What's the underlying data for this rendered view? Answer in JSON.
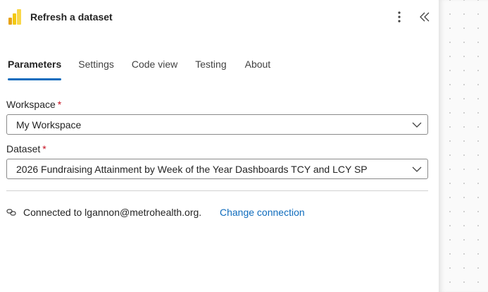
{
  "header": {
    "title": "Refresh a dataset",
    "logo_icon": "power-bi-logo",
    "more_icon": "more-vertical-icon",
    "collapse_icon": "chevron-double-left-icon"
  },
  "tabs": [
    {
      "label": "Parameters",
      "active": true
    },
    {
      "label": "Settings",
      "active": false
    },
    {
      "label": "Code view",
      "active": false
    },
    {
      "label": "Testing",
      "active": false
    },
    {
      "label": "About",
      "active": false
    }
  ],
  "workspace": {
    "label": "Workspace",
    "required_mark": "*",
    "value": "My Workspace"
  },
  "dataset": {
    "label": "Dataset",
    "required_mark": "*",
    "value": "2026 Fundraising Attainment by Week of the Year Dashboards TCY and LCY SP"
  },
  "connection": {
    "icon": "link-icon",
    "text": "Connected to lgannon@metrohealth.org.",
    "change_label": "Change connection"
  },
  "colors": {
    "accent": "#0f6cbd",
    "required": "#c50f1f",
    "powerbi_yellow": "#f2c811"
  }
}
